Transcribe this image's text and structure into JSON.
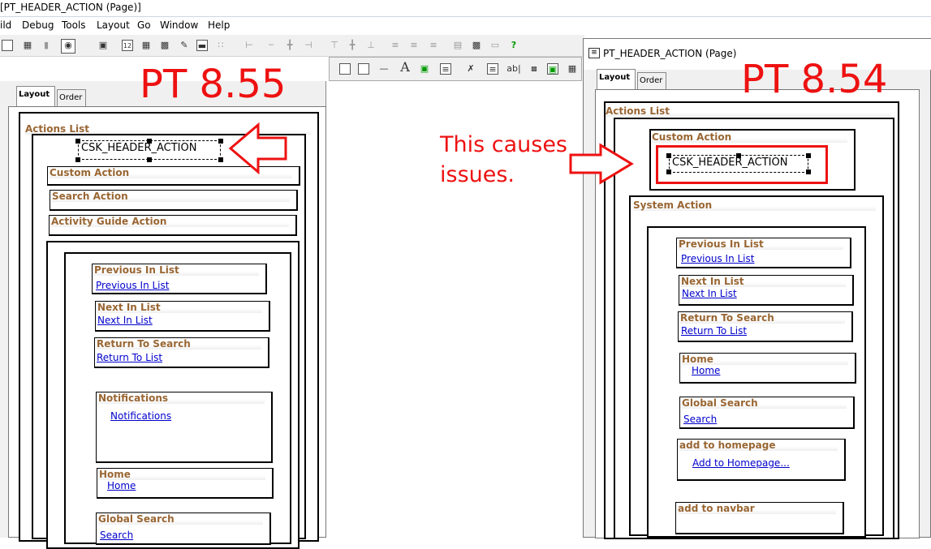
{
  "window": {
    "title": "[PT_HEADER_ACTION (Page)]"
  },
  "menu": [
    "ild",
    "Debug",
    "Tools",
    "Layout",
    "Go",
    "Window",
    "Help"
  ],
  "left_page": {
    "tabs": [
      "Layout",
      "Order"
    ],
    "actions_list": "Actions List",
    "field": "CSK_HEADER_ACTION",
    "groups": [
      "Custom Action",
      "Search Action",
      "Activity Guide Action"
    ],
    "items": [
      {
        "title": "Previous In List",
        "link": "Previous In List"
      },
      {
        "title": "Next In List",
        "link": "Next In List"
      },
      {
        "title": "Return To Search",
        "link": "Return To List"
      },
      {
        "title": "Notifications",
        "link": "Notifications"
      },
      {
        "title": "Home",
        "link": "Home"
      },
      {
        "title": "Global Search",
        "link": "Search"
      }
    ]
  },
  "right_page": {
    "title": "PT_HEADER_ACTION (Page)",
    "tabs": [
      "Layout",
      "Order"
    ],
    "actions_list": "Actions List",
    "custom_action": "Custom Action",
    "field": "CSK_HEADER_ACTION",
    "system_action": "System Action",
    "items": [
      {
        "title": "Previous In List",
        "link": "Previous In List"
      },
      {
        "title": "Next In List",
        "link": "Next In List"
      },
      {
        "title": "Return To Search",
        "link": "Return To List"
      },
      {
        "title": "Home",
        "link": "Home"
      },
      {
        "title": "Global Search",
        "link": "Search"
      },
      {
        "title": "add to homepage",
        "link": "Add to Homepage..."
      },
      {
        "title": "add to navbar",
        "link": ""
      }
    ]
  },
  "annotations": {
    "pt855": "PT 8.55",
    "pt854": "PT 8.54",
    "issue": [
      "This causes",
      "issues."
    ]
  },
  "colors": {
    "accent_red": "#ee1111",
    "group_title": "#996633",
    "link": "#0000cc"
  }
}
